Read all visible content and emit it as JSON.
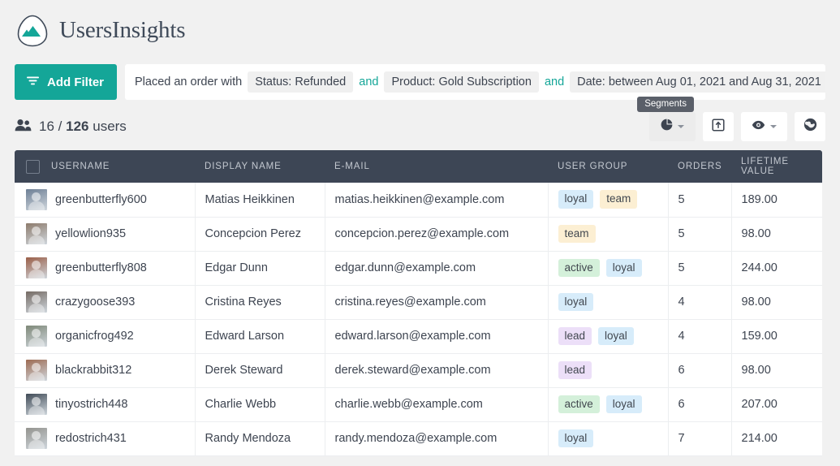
{
  "brand": {
    "name": "UsersInsights",
    "accent": "#14a698",
    "logo_icon": "mountain-logo-icon"
  },
  "filter_bar": {
    "add_filter_label": "Add Filter",
    "filter_icon": "filter-icon",
    "prefix_text": "Placed an order with",
    "conjunction": "and",
    "chips": [
      "Status: Refunded",
      "Product: Gold Subscription",
      "Date: between Aug 01, 2021 and Aug 31, 2021"
    ],
    "close_icon": "close-icon"
  },
  "summary": {
    "users_icon": "users-icon",
    "visible_count": "16",
    "separator": "/",
    "total_count": "126",
    "unit_label": "users"
  },
  "toolbar": {
    "tooltip": "Segments",
    "buttons": [
      {
        "name": "segments-button",
        "icon": "pie-chart-icon",
        "has_caret": true,
        "active": true
      },
      {
        "name": "export-button",
        "icon": "export-box-icon",
        "has_caret": false,
        "active": false
      },
      {
        "name": "visibility-button",
        "icon": "eye-icon",
        "has_caret": true,
        "active": false
      },
      {
        "name": "globe-button",
        "icon": "globe-icon",
        "has_caret": false,
        "active": false
      }
    ]
  },
  "table": {
    "select_all_checkbox": "select-all-checkbox",
    "columns": [
      "USERNAME",
      "DISPLAY NAME",
      "E-MAIL",
      "USER GROUP",
      "ORDERS",
      "LIFETIME VALUE"
    ],
    "rows": [
      {
        "username": "greenbutterfly600",
        "display_name": "Matias Heikkinen",
        "email": "matias.heikkinen@example.com",
        "groups": [
          "loyal",
          "team"
        ],
        "orders": "5",
        "lifetime_value": "189.00",
        "avatar_tone": "#6d7f95"
      },
      {
        "username": "yellowlion935",
        "display_name": "Concepcion Perez",
        "email": "concepcion.perez@example.com",
        "groups": [
          "team"
        ],
        "orders": "5",
        "lifetime_value": "98.00",
        "avatar_tone": "#8d7b6c"
      },
      {
        "username": "greenbutterfly808",
        "display_name": "Edgar Dunn",
        "email": "edgar.dunn@example.com",
        "groups": [
          "active",
          "loyal"
        ],
        "orders": "5",
        "lifetime_value": "244.00",
        "avatar_tone": "#9a5e47"
      },
      {
        "username": "crazygoose393",
        "display_name": "Cristina Reyes",
        "email": "cristina.reyes@example.com",
        "groups": [
          "loyal"
        ],
        "orders": "4",
        "lifetime_value": "98.00",
        "avatar_tone": "#746a63"
      },
      {
        "username": "organicfrog492",
        "display_name": "Edward Larson",
        "email": "edward.larson@example.com",
        "groups": [
          "lead",
          "loyal"
        ],
        "orders": "4",
        "lifetime_value": "159.00",
        "avatar_tone": "#7e8878"
      },
      {
        "username": "blackrabbit312",
        "display_name": "Derek Steward",
        "email": "derek.steward@example.com",
        "groups": [
          "lead"
        ],
        "orders": "6",
        "lifetime_value": "98.00",
        "avatar_tone": "#9d6b52"
      },
      {
        "username": "tinyostrich448",
        "display_name": "Charlie Webb",
        "email": "charlie.webb@example.com",
        "groups": [
          "active",
          "loyal"
        ],
        "orders": "6",
        "lifetime_value": "207.00",
        "avatar_tone": "#3f4a56"
      },
      {
        "username": "redostrich431",
        "display_name": "Randy Mendoza",
        "email": "randy.mendoza@example.com",
        "groups": [
          "loyal"
        ],
        "orders": "7",
        "lifetime_value": "214.00",
        "avatar_tone": "#93938e"
      }
    ]
  },
  "tag_colors": {
    "loyal": "#d7ecfa",
    "team": "#fcefd3",
    "active": "#d4f0da",
    "lead": "#ecdff8"
  }
}
